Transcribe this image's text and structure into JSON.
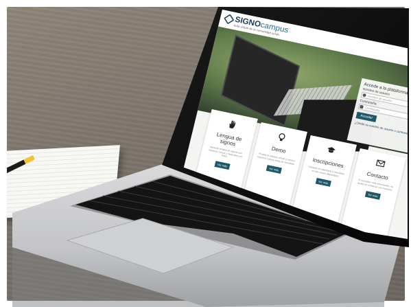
{
  "site": {
    "logo_main": "SIGNO",
    "logo_sub": "campus",
    "logo_tag": "Aula virtual de la comunidad sorda"
  },
  "login": {
    "title": "Accede a la plataforma",
    "username_label": "Nombre de usuario",
    "username_placeholder": "Nombre de usuario",
    "password_label": "Contraseña",
    "password_placeholder": "Contraseña",
    "submit_label": "Acceder",
    "forgot_link": "¿Olvidó su nombre de usuario o contraseña?"
  },
  "cards": [
    {
      "title": "Lengua de signos",
      "text": "Aprende lengua de signos con nuestros cursos y materiales en línea.",
      "button": "Ver más",
      "icon": "hand-icon"
    },
    {
      "title": "Demo",
      "text": "Prueba el campus virtual y conoce nuestros cursos antes de inscribirte.",
      "button": "Ver más",
      "icon": "lightbulb-icon"
    },
    {
      "title": "Inscripciones",
      "text": "Consulta el calendario e inscríbete en los cursos disponibles.",
      "button": "Ver más",
      "icon": "graduation-cap-icon"
    },
    {
      "title": "Contacto",
      "text": "Si necesitas más información, no dudes en contactar con nosotros.",
      "button": "Ver más",
      "icon": "envelope-icon"
    }
  ],
  "colors": {
    "accent": "#1e5766",
    "logo": "#1e3c5a",
    "table": "#7c746b"
  }
}
